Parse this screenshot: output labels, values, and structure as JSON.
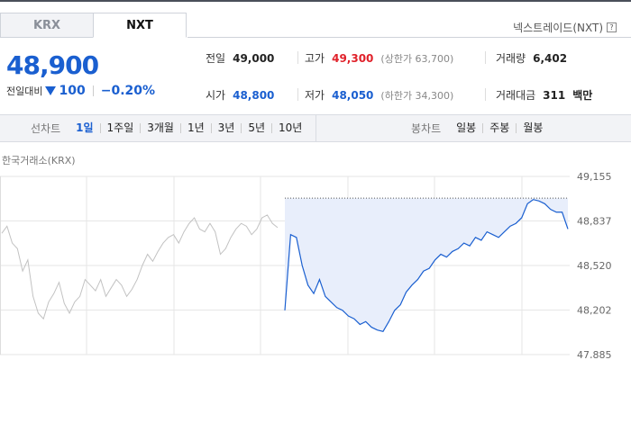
{
  "tabs": [
    {
      "label": "KRX"
    },
    {
      "label": "NXT"
    }
  ],
  "exchange_label": "넥스트레이드(NXT)",
  "help_icon": "?",
  "current_price": "48,900",
  "change": {
    "label": "전일대비",
    "direction": "down",
    "amount": "100",
    "percent": "−0.20%"
  },
  "stats": {
    "prev_close": {
      "label": "전일",
      "value": "49,000"
    },
    "high": {
      "label": "고가",
      "value": "49,300",
      "limit": "(상한가 63,700)"
    },
    "volume": {
      "label": "거래량",
      "value": "6,402"
    },
    "open": {
      "label": "시가",
      "value": "48,800"
    },
    "low": {
      "label": "저가",
      "value": "48,050",
      "limit": "(하한가 34,300)"
    },
    "trade_value": {
      "label": "거래대금",
      "value": "311",
      "unit": "백만"
    }
  },
  "line_chart_periods": {
    "label": "선차트",
    "items": [
      "1일",
      "1주일",
      "3개월",
      "1년",
      "3년",
      "5년",
      "10년"
    ],
    "selected": "1일"
  },
  "candle_chart_periods": {
    "label": "봉차트",
    "items": [
      "일봉",
      "주봉",
      "월봉"
    ]
  },
  "colors": {
    "accent": "#1a5fd0",
    "up": "#e0212a",
    "prev_day_line": "#c2c2c2",
    "fill": "#e8eefb"
  },
  "chart_data": {
    "type": "line",
    "source_label": "한국거래소(KRX)",
    "y_ticks": [
      "49,155",
      "48,837",
      "48,520",
      "48,202",
      "47,885"
    ],
    "ylim": [
      47885,
      49155
    ],
    "reference_line": 49000,
    "series": [
      {
        "role": "previous-day",
        "values": [
          48750,
          48800,
          48680,
          48640,
          48480,
          48560,
          48300,
          48180,
          48140,
          48260,
          48320,
          48400,
          48250,
          48180,
          48260,
          48300,
          48420,
          48380,
          48340,
          48420,
          48300,
          48360,
          48420,
          48380,
          48300,
          48350,
          48420,
          48520,
          48600,
          48550,
          48620,
          48680,
          48720,
          48740,
          48680,
          48760,
          48820,
          48860,
          48780,
          48760,
          48820,
          48760,
          48600,
          48640,
          48720,
          48780,
          48820,
          48800,
          48740,
          48780,
          48860,
          48880,
          48820,
          48790
        ]
      },
      {
        "role": "today",
        "values": [
          48200,
          48740,
          48720,
          48520,
          48380,
          48320,
          48420,
          48300,
          48260,
          48220,
          48200,
          48160,
          48140,
          48100,
          48120,
          48080,
          48060,
          48050,
          48120,
          48200,
          48240,
          48330,
          48380,
          48420,
          48480,
          48500,
          48560,
          48600,
          48580,
          48620,
          48640,
          48680,
          48660,
          48720,
          48700,
          48760,
          48740,
          48720,
          48760,
          48800,
          48820,
          48860,
          48960,
          48990,
          48980,
          48960,
          48920,
          48900,
          48900,
          48780
        ]
      }
    ]
  }
}
